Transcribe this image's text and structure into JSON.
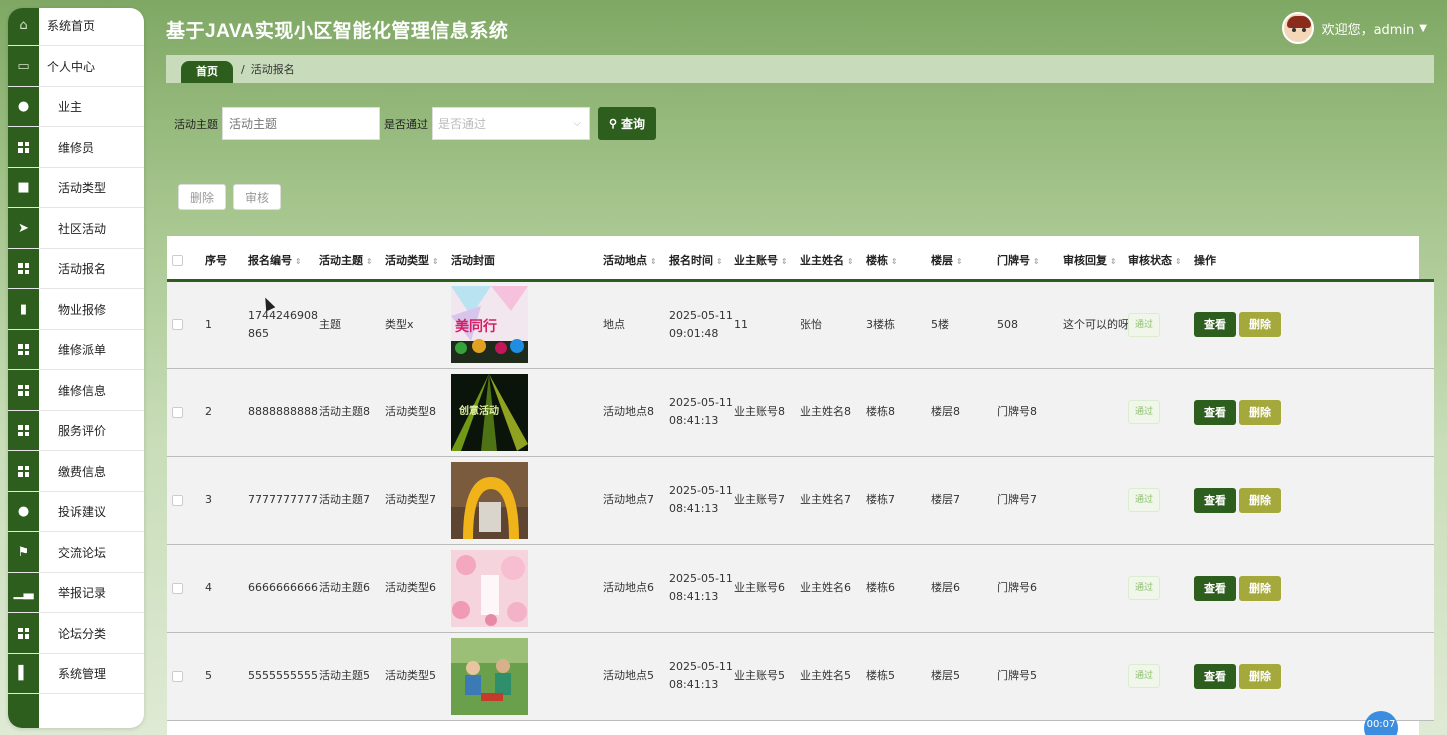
{
  "app": {
    "title": "基于JAVA实现小区智能化管理信息系统",
    "welcome": "欢迎您，admin"
  },
  "sidebar": {
    "items": [
      {
        "label": "系统首页",
        "icon": "home-icon"
      },
      {
        "label": "个人中心",
        "icon": "card-icon"
      },
      {
        "label": "业主",
        "icon": "user-icon"
      },
      {
        "label": "维修员",
        "icon": "grid-icon"
      },
      {
        "label": "活动类型",
        "icon": "briefcase-icon"
      },
      {
        "label": "社区活动",
        "icon": "send-icon"
      },
      {
        "label": "活动报名",
        "icon": "grid-icon"
      },
      {
        "label": "物业报修",
        "icon": "clipboard-icon"
      },
      {
        "label": "维修派单",
        "icon": "grid-icon"
      },
      {
        "label": "维修信息",
        "icon": "grid-icon"
      },
      {
        "label": "服务评价",
        "icon": "grid-icon"
      },
      {
        "label": "缴费信息",
        "icon": "grid-icon"
      },
      {
        "label": "投诉建议",
        "icon": "user-icon"
      },
      {
        "label": "交流论坛",
        "icon": "flag-icon"
      },
      {
        "label": "举报记录",
        "icon": "bar-chart-icon"
      },
      {
        "label": "论坛分类",
        "icon": "grid-icon"
      },
      {
        "label": "系统管理",
        "icon": "book-icon"
      }
    ]
  },
  "breadcrumb": {
    "home": "首页",
    "separator": "/",
    "current": "活动报名"
  },
  "search": {
    "topic_label": "活动主题",
    "topic_placeholder": "活动主题",
    "approved_label": "是否通过",
    "approved_placeholder": "是否通过",
    "query_button": "查询"
  },
  "actions": {
    "delete": "删除",
    "review": "审核"
  },
  "table": {
    "columns": [
      "序号",
      "报名编号",
      "活动主题",
      "活动类型",
      "活动封面",
      "活动地点",
      "报名时间",
      "业主账号",
      "业主姓名",
      "楼栋",
      "楼层",
      "门牌号",
      "审核回复",
      "审核状态",
      "操作"
    ],
    "view_label": "查看",
    "delete_label": "删除",
    "rows": [
      {
        "index": "1",
        "code": "1744246908865",
        "topic": "主题",
        "type": "类型x",
        "location": "地点",
        "time": "2025-05-11 09:01:48",
        "account": "11",
        "name": "张怡",
        "building": "3楼栋",
        "floor": "5楼",
        "door": "508",
        "reply": "这个可以的呀",
        "status": "通过"
      },
      {
        "index": "2",
        "code": "8888888888",
        "topic": "活动主题8",
        "type": "活动类型8",
        "location": "活动地点8",
        "time": "2025-05-11 08:41:13",
        "account": "业主账号8",
        "name": "业主姓名8",
        "building": "楼栋8",
        "floor": "楼层8",
        "door": "门牌号8",
        "reply": "",
        "status": "通过"
      },
      {
        "index": "3",
        "code": "7777777777",
        "topic": "活动主题7",
        "type": "活动类型7",
        "location": "活动地点7",
        "time": "2025-05-11 08:41:13",
        "account": "业主账号7",
        "name": "业主姓名7",
        "building": "楼栋7",
        "floor": "楼层7",
        "door": "门牌号7",
        "reply": "",
        "status": "通过"
      },
      {
        "index": "4",
        "code": "6666666666",
        "topic": "活动主题6",
        "type": "活动类型6",
        "location": "活动地点6",
        "time": "2025-05-11 08:41:13",
        "account": "业主账号6",
        "name": "业主姓名6",
        "building": "楼栋6",
        "floor": "楼层6",
        "door": "门牌号6",
        "reply": "",
        "status": "通过"
      },
      {
        "index": "5",
        "code": "5555555555",
        "topic": "活动主题5",
        "type": "活动类型5",
        "location": "活动地点5",
        "time": "2025-05-11 08:41:13",
        "account": "业主账号5",
        "name": "业主姓名5",
        "building": "楼栋5",
        "floor": "楼层5",
        "door": "门牌号5",
        "reply": "",
        "status": "通过"
      }
    ]
  },
  "timer": "00:07",
  "colors": {
    "primary": "#2e5e1e",
    "delete": "#a5a83a",
    "badge_text": "#8dbe6e"
  }
}
